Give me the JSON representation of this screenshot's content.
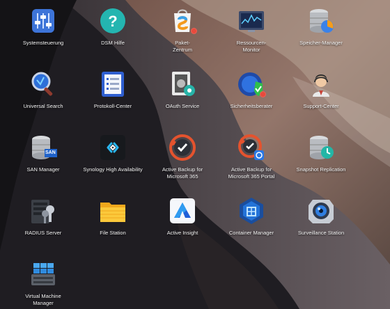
{
  "apps": [
    {
      "label": "Systemsteuerung",
      "icon": "control-panel-icon"
    },
    {
      "label": "DSM Hilfe",
      "icon": "help-icon"
    },
    {
      "label": "Paket-\nZentrum",
      "icon": "package-center-icon"
    },
    {
      "label": "Ressourcen-\nMonitor",
      "icon": "resource-monitor-icon"
    },
    {
      "label": "Speicher-Manager",
      "icon": "storage-manager-icon"
    },
    {
      "label": "Universal Search",
      "icon": "search-icon"
    },
    {
      "label": "Protokoll-Center",
      "icon": "log-center-icon"
    },
    {
      "label": "OAuth Service",
      "icon": "oauth-service-icon"
    },
    {
      "label": "Sicherheitsberater",
      "icon": "security-advisor-icon"
    },
    {
      "label": "Support-Center",
      "icon": "support-center-icon"
    },
    {
      "label": "SAN Manager",
      "icon": "san-manager-icon"
    },
    {
      "label": "Synology High Availability",
      "icon": "high-availability-icon"
    },
    {
      "label": "Active Backup for\nMicrosoft 365",
      "icon": "active-backup-icon"
    },
    {
      "label": "Active Backup for\nMicrosoft 365 Portal",
      "icon": "active-backup-portal-icon"
    },
    {
      "label": "Snapshot Replication",
      "icon": "snapshot-replication-icon"
    },
    {
      "label": "RADIUS Server",
      "icon": "radius-server-icon"
    },
    {
      "label": "File Station",
      "icon": "file-station-icon"
    },
    {
      "label": "Active Insight",
      "icon": "active-insight-icon"
    },
    {
      "label": "Container Manager",
      "icon": "container-manager-icon"
    },
    {
      "label": "Surveillance Station",
      "icon": "surveillance-station-icon"
    },
    {
      "label": "Virtual Machine\nManager",
      "icon": "virtual-machine-manager-icon"
    }
  ],
  "san_badge": "SAN",
  "colors": {
    "notification_dot": "#e84a3c",
    "label_text": "#f3f3f3"
  }
}
